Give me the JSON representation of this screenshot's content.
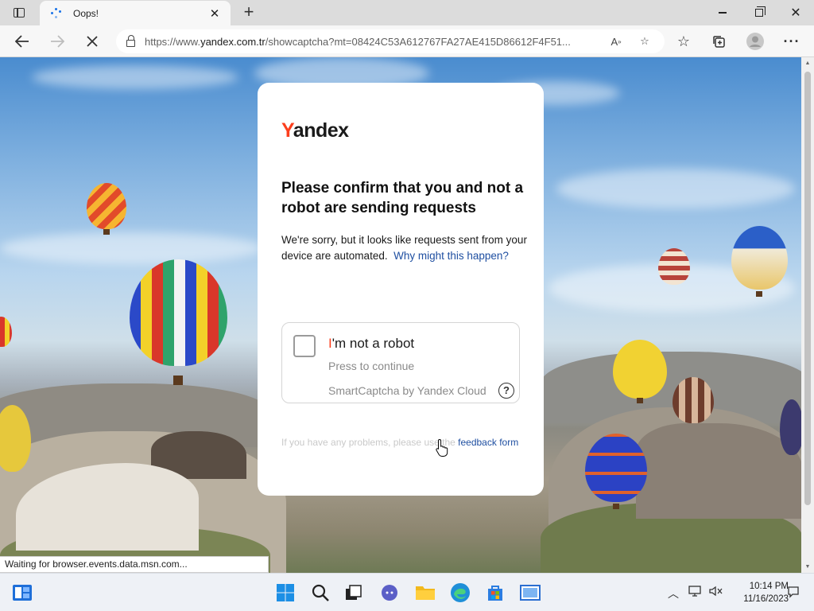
{
  "browser": {
    "tab": {
      "title": "Oops!"
    },
    "address_bar": {
      "url_prefix": "https://www.",
      "url_host": "yandex.com.tr",
      "url_path": "/showcaptcha?mt=08424C53A612767FA27AE415D86612F4F51..."
    },
    "status_text": "Waiting for browser.events.data.msn.com..."
  },
  "icons": {
    "tab_actions": "tab-actions-icon",
    "loading": "loading-spinner-icon",
    "back": "back-arrow-icon",
    "forward": "forward-arrow-icon",
    "stop": "stop-loading-icon",
    "lock": "lock-icon",
    "read_aloud": "read-aloud-icon",
    "add_favorite": "add-favorite-icon",
    "favorites": "favorites-icon",
    "collections": "collections-icon",
    "profile": "profile-avatar-icon",
    "more": "more-options-icon"
  },
  "page": {
    "logo_y": "Y",
    "logo_rest": "andex",
    "heading": "Please confirm that you and not a robot are sending requests",
    "description": "We're sorry, but it looks like requests sent from your device are automated.",
    "why_link": "Why might this happen?",
    "captcha": {
      "label_first": "I",
      "label_rest": "'m not a robot",
      "hint": "Press to continue",
      "brand": "SmartCaptcha by Yandex Cloud",
      "help": "?"
    },
    "footer_text": "If you have any problems, please use the",
    "footer_link": "feedback form"
  },
  "taskbar": {
    "time": "10:14 PM",
    "date": "11/16/2023"
  },
  "colors": {
    "yandex_red": "#fc3f1d",
    "link_blue": "#1f4fa1",
    "edge_accent": "#1a73e8"
  }
}
